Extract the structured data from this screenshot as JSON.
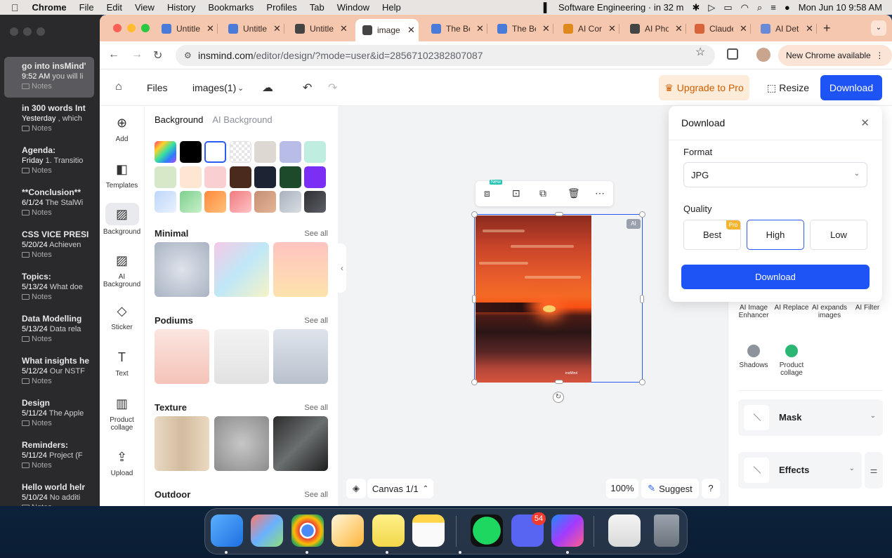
{
  "menubar": {
    "app": "Chrome",
    "items": [
      "File",
      "Edit",
      "View",
      "History",
      "Bookmarks",
      "Profiles",
      "Tab",
      "Window",
      "Help"
    ],
    "calendar": "Software Engineering · in 32 m",
    "datetime": "Mon Jun 10  9:58 AM"
  },
  "notes": [
    {
      "title": "go into insMind'",
      "time": "9:52 AM",
      "preview": "you will li",
      "folder": "Notes"
    },
    {
      "title": "in 300 words Int",
      "time": "Yesterday",
      "preview": ", which",
      "folder": "Notes"
    },
    {
      "title": "Agenda:",
      "time": "Friday",
      "preview": "1. Transitio",
      "folder": "Notes"
    },
    {
      "title": "**Conclusion**",
      "time": "6/1/24",
      "preview": "The StalWi",
      "folder": "Notes"
    },
    {
      "title": "CSS VICE PRESI",
      "time": "5/20/24",
      "preview": "Achieven",
      "folder": "Notes"
    },
    {
      "title": "Topics:",
      "time": "5/13/24",
      "preview": "What doe",
      "folder": "Notes"
    },
    {
      "title": "Data Modelling",
      "time": "5/13/24",
      "preview": "Data rela",
      "folder": "Notes"
    },
    {
      "title": "What insights he",
      "time": "5/12/24",
      "preview": "Our NSTF",
      "folder": "Notes"
    },
    {
      "title": "Design",
      "time": "5/11/24",
      "preview": "The Apple",
      "folder": "Notes"
    },
    {
      "title": "Reminders:",
      "time": "5/11/24",
      "preview": "Project (F",
      "folder": "Notes"
    },
    {
      "title": "Hello world helr",
      "time": "5/10/24",
      "preview": "No additi",
      "folder": "Notes"
    }
  ],
  "tabs": [
    {
      "title": "Untitle",
      "color": "#4a7bd8"
    },
    {
      "title": "Untitle",
      "color": "#4a7bd8"
    },
    {
      "title": "Untitle",
      "color": "#444444"
    },
    {
      "title": "image",
      "color": "#444444"
    },
    {
      "title": "The Be",
      "color": "#4a7bd8"
    },
    {
      "title": "The Be",
      "color": "#4a7bd8"
    },
    {
      "title": "AI Cor",
      "color": "#e08a1e"
    },
    {
      "title": "AI Pho",
      "color": "#444444"
    },
    {
      "title": "Claude",
      "color": "#d9643b"
    },
    {
      "title": "AI Det",
      "color": "#6a8ad8"
    }
  ],
  "address": {
    "url_host": "insmind.com",
    "url_path": "/editor/design/?mode=user&id=28567102382807087",
    "new_chrome": "New Chrome available"
  },
  "topbar": {
    "files": "Files",
    "filename": "images(1)",
    "upgrade": "Upgrade to Pro",
    "resize": "Resize",
    "download": "Download"
  },
  "leftnav": [
    {
      "label": "Add",
      "icon": "add-icon",
      "glyph": "⊕"
    },
    {
      "label": "Templates",
      "icon": "templates-icon",
      "glyph": "◧"
    },
    {
      "label": "Background",
      "icon": "background-icon",
      "glyph": "▨"
    },
    {
      "label": "AI Background",
      "icon": "ai-background-icon",
      "glyph": "▨"
    },
    {
      "label": "Sticker",
      "icon": "sticker-icon",
      "glyph": "◇"
    },
    {
      "label": "Text",
      "icon": "text-icon",
      "glyph": "T"
    },
    {
      "label": "Product collage",
      "icon": "collage-icon",
      "glyph": "▥"
    },
    {
      "label": "Upload",
      "icon": "upload-icon",
      "glyph": "⇪"
    }
  ],
  "panel": {
    "tab_background": "Background",
    "tab_ai": "AI Background",
    "swatches": [
      "linear-gradient(135deg,#ff3b6b,#ffd02a,#36e0a0,#2f7bff,#b24bff)",
      "#000000",
      "#ffffff",
      "checker",
      "#ddd9d2",
      "#b8bde8",
      "#bfeee0",
      "#d7e8c8",
      "#fde6d2",
      "#f9cfd1",
      "#4a2a1c",
      "#1c2433",
      "#1d4a2a",
      "#7b2ff5",
      "linear-gradient(135deg,#bdd6f8,#e9f2ff)",
      "linear-gradient(135deg,#7fcf8f,#c6f0c9)",
      "linear-gradient(135deg,#ff8a3c,#ffc07a)",
      "linear-gradient(135deg,#f07a7f,#ffc3c5)",
      "linear-gradient(135deg,#c58e72,#e4b597)",
      "linear-gradient(135deg,#a9b1bd,#d9dde3)",
      "linear-gradient(135deg,#2d2f33,#5c5f66)"
    ],
    "see_all": "See all",
    "sections": [
      {
        "title": "Minimal",
        "thumbs": [
          "radial-gradient(circle,#dfe3ea,#a9b3c3)",
          "linear-gradient(135deg,#f6c9e6,#bfe8f7,#f8f3c6)",
          "linear-gradient(180deg,#ffc3c0,#fde3ad)"
        ]
      },
      {
        "title": "Podiums",
        "thumbs": [
          "linear-gradient(180deg,#fbe5df,#f4c3b8)",
          "linear-gradient(180deg,#f3f3f3,#e1e1e1)",
          "linear-gradient(180deg,#dfe4ec,#b9c1cd)"
        ]
      },
      {
        "title": "Texture",
        "thumbs": [
          "linear-gradient(90deg,#e9d9c3,#d2bb9f,#ead9c1)",
          "radial-gradient(circle,#c7c7c7,#8c8c8c)",
          "linear-gradient(135deg,#2d2d2d,#6b6f70,#1e1e1e)"
        ]
      },
      {
        "title": "Outdoor",
        "thumbs": []
      }
    ]
  },
  "canvas": {
    "ai_tag": "AI",
    "new_badge": "New",
    "watermark": "insMind",
    "canvas_label": "Canvas 1/1",
    "zoom": "100%",
    "suggest": "Suggest",
    "help": "?"
  },
  "right_tools": [
    {
      "label": "AI Image Enhancer",
      "color": "#cfd3da"
    },
    {
      "label": "AI Replace",
      "color": "#cfd3da"
    },
    {
      "label": "AI expands images",
      "color": "#cfd3da"
    },
    {
      "label": "AI Filter",
      "color": "#cfd3da"
    },
    {
      "label": "Shadows",
      "color": "#8f939b"
    },
    {
      "label": "Product collage",
      "color": "#2bb673"
    }
  ],
  "accordions": {
    "mask": "Mask",
    "effects": "Effects"
  },
  "download_dialog": {
    "title": "Download",
    "format_label": "Format",
    "format_value": "JPG",
    "quality_label": "Quality",
    "qualities": [
      "Best",
      "High",
      "Low"
    ],
    "selected_quality": "High",
    "pro": "Pro",
    "button": "Download"
  },
  "dock": [
    {
      "name": "finder",
      "color": "linear-gradient(135deg,#5ab0ff,#1d6fe0)"
    },
    {
      "name": "launchpad",
      "color": "linear-gradient(135deg,#ff7a6a,#6ab0ff,#8ee07a)"
    },
    {
      "name": "chrome",
      "color": "radial-gradient(circle,#4a8af4 26%,#fff 28%,#fff 34%,#e94235 36%,#fbbc05 60%,#34a853 80%)"
    },
    {
      "name": "pages",
      "color": "linear-gradient(135deg,#fff5d9,#ffb53a)"
    },
    {
      "name": "stickies",
      "color": "linear-gradient(180deg,#fff08a,#f2d74a)"
    },
    {
      "name": "notes",
      "color": "linear-gradient(180deg,#ffd64a 0%,#ffd64a 25%,#fafafa 26%)"
    },
    {
      "name": "spotify",
      "color": "radial-gradient(circle,#1ed760 60%,#111 62%)"
    },
    {
      "name": "discord",
      "color": "#5865f2"
    },
    {
      "name": "messenger",
      "color": "linear-gradient(135deg,#1f8bff,#a33bff,#ff5c8a)"
    },
    {
      "name": "preview",
      "color": "linear-gradient(180deg,#f4f4f4,#d9d9d9)"
    },
    {
      "name": "trash",
      "color": "linear-gradient(180deg,#9aa3ad,#6b737c)"
    }
  ],
  "discord_badge": "54"
}
